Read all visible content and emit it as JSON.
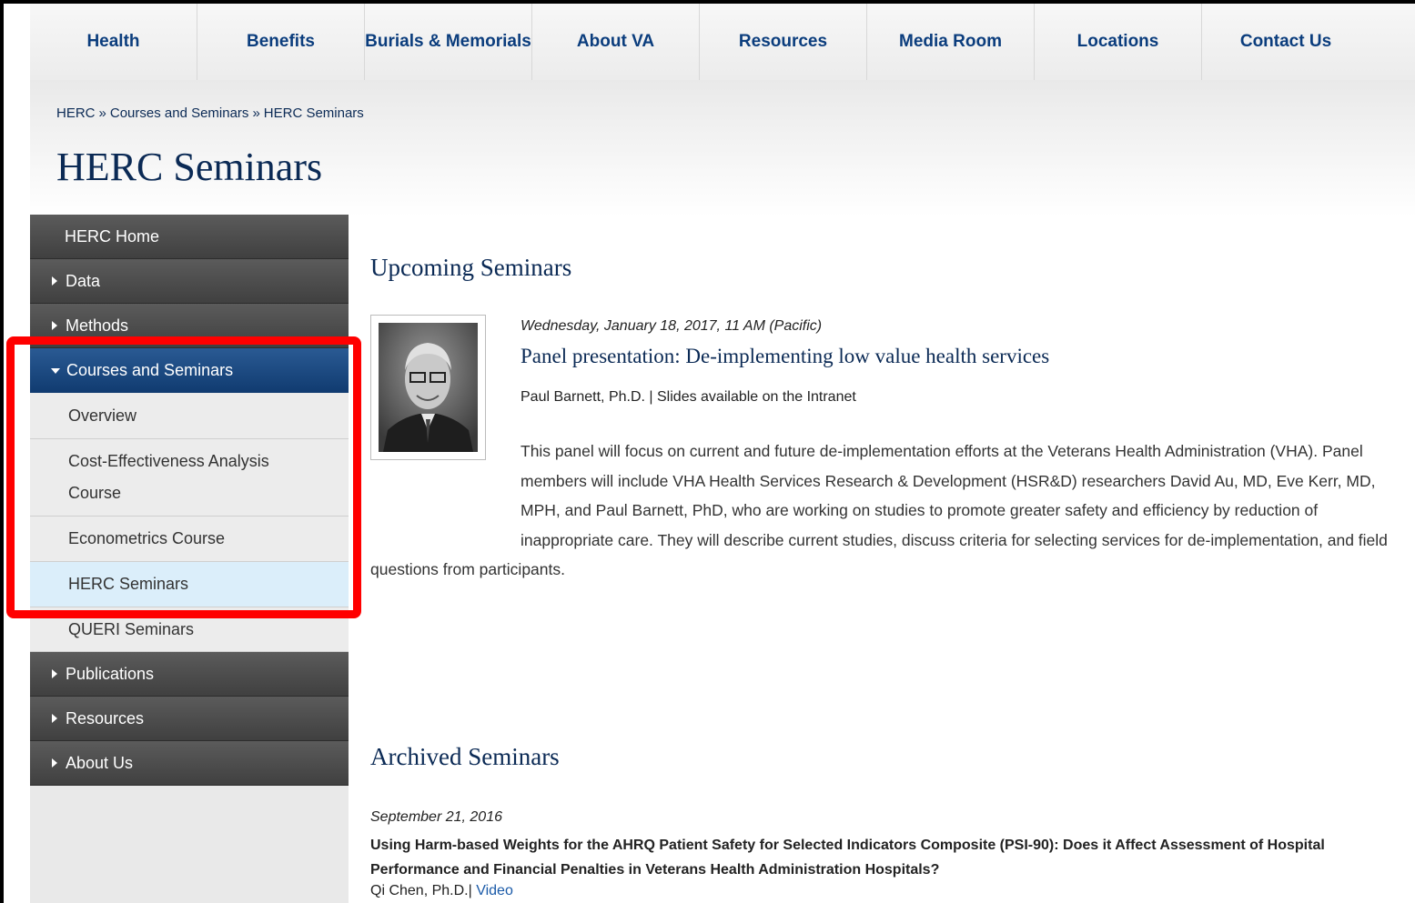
{
  "nav": {
    "items": [
      "Health",
      "Benefits",
      "Burials & Memorials",
      "About VA",
      "Resources",
      "Media Room",
      "Locations",
      "Contact Us"
    ]
  },
  "breadcrumb": {
    "items": [
      "HERC",
      "Courses and Seminars",
      "HERC Seminars"
    ],
    "separator": "»"
  },
  "page": {
    "title": "HERC Seminars"
  },
  "sidebar": {
    "home": "HERC Home",
    "data": "Data",
    "methods": "Methods",
    "courses": "Courses and Seminars",
    "sub": {
      "overview": "Overview",
      "cea": "Cost-Effectiveness Analysis Course",
      "econometrics": "Econometrics Course",
      "herc_seminars": "HERC Seminars",
      "queri": "QUERI Seminars"
    },
    "publications": "Publications",
    "resources": "Resources",
    "about": "About Us"
  },
  "upcoming": {
    "heading": "Upcoming Seminars",
    "date": "Wednesday, January 18, 2017, 11 AM (Pacific)",
    "title": "Panel presentation: De-implementing low value health services",
    "presenter": "Paul Barnett, Ph.D. | Slides available on the Intranet",
    "description": "This panel will focus on current and future de-implementation efforts at the Veterans Health Administration (VHA). Panel members will include VHA Health Services Research & Development (HSR&D) researchers David Au, MD, Eve Kerr, MD, MPH, and Paul Barnett, PhD, who are working on studies to promote greater safety and efficiency by reduction of inappropriate care. They will describe current studies, discuss criteria for selecting services for de-implementation, and field questions from participants."
  },
  "archived": {
    "heading": "Archived Seminars",
    "date": "September 21, 2016",
    "title": "Using Harm-based Weights for the AHRQ Patient Safety for Selected Indicators Composite (PSI-90): Does it Affect Assessment of Hospital Performance and Financial Penalties in Veterans Health Administration Hospitals?",
    "presenter": "Qi Chen, Ph.D.|",
    "video_label": "Video"
  },
  "colors": {
    "navy": "#0b2a55",
    "nav_text": "#0b3d7d",
    "active_blue": "#103b70",
    "highlight_red": "#ff0000",
    "current_item": "#dbeefa"
  }
}
